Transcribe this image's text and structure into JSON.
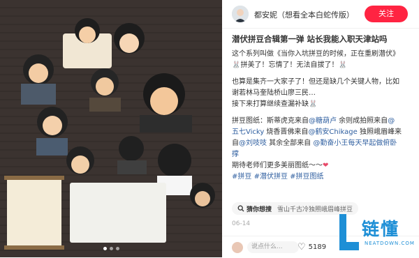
{
  "header": {
    "username": "都安妮（想看全本白蛇传版）",
    "follow_label": "关注"
  },
  "post": {
    "title": "潜伏拼豆合辑第一弹 站长我能入职天津站吗",
    "lines": [
      "这个系列叫做《当你入坑拼豆的时候，正在重刷潜伏》",
      "🐰拼美了！忘情了！无法自拔了！🐰",
      "",
      "也算是集齐一大家子了！但还是缺几个关键人物，比如",
      "谢若林马奎陆桥山廖三民…",
      "接下来打算继续查漏补缺🐰",
      ""
    ],
    "credits_line1_a": "拼豆图纸：斯蒂虎克来自",
    "credits_at1": "@糖葫卢",
    "credits_line1_b": " 余则成拍照来自",
    "credits_line1_c": "@",
    "credits_at2": "五七Vicky",
    "credits_line2_a": " 烧香晋佛来自",
    "credits_at3": "@鹤安Chikage",
    "credits_line2_b": " 独照峨眉峰来",
    "credits_line3_a": "自",
    "credits_at4": "@刘吱吱",
    "credits_line3_b": " 其余全部来自 ",
    "credits_at5": "@勤奋小王每天早起做俯卧",
    "credits_line4": "撑",
    "thanks": "期待老师们更多美丽图纸～～",
    "heart": "❤",
    "tags": [
      "#拼豆",
      "#潜伏拼豆",
      "#拼豆图纸"
    ]
  },
  "guess": {
    "icon": "search-icon",
    "label": "猜你想搜",
    "query": "雪山千古冷独照峨眉峰拼豆"
  },
  "date": "06-14",
  "footer": {
    "comment_placeholder": "说点什么...",
    "likes": "5189"
  },
  "photo_signs": [
    "妹子你真様",
    "还是你懂我",
    "我还阳回还",
    "太妖了吧！",
    "打我拼插",
    "请你敬拜",
    "言任我",
    "佛香晋烧",
    "独照峨眉峰",
    "雪山千古冷"
  ],
  "watermark": {
    "text": "链懂",
    "sub": "NEATDOWN.COM",
    "color": "#1e8fd6"
  },
  "colors": {
    "accent": "#ff2442",
    "link": "#2f5fa0"
  }
}
